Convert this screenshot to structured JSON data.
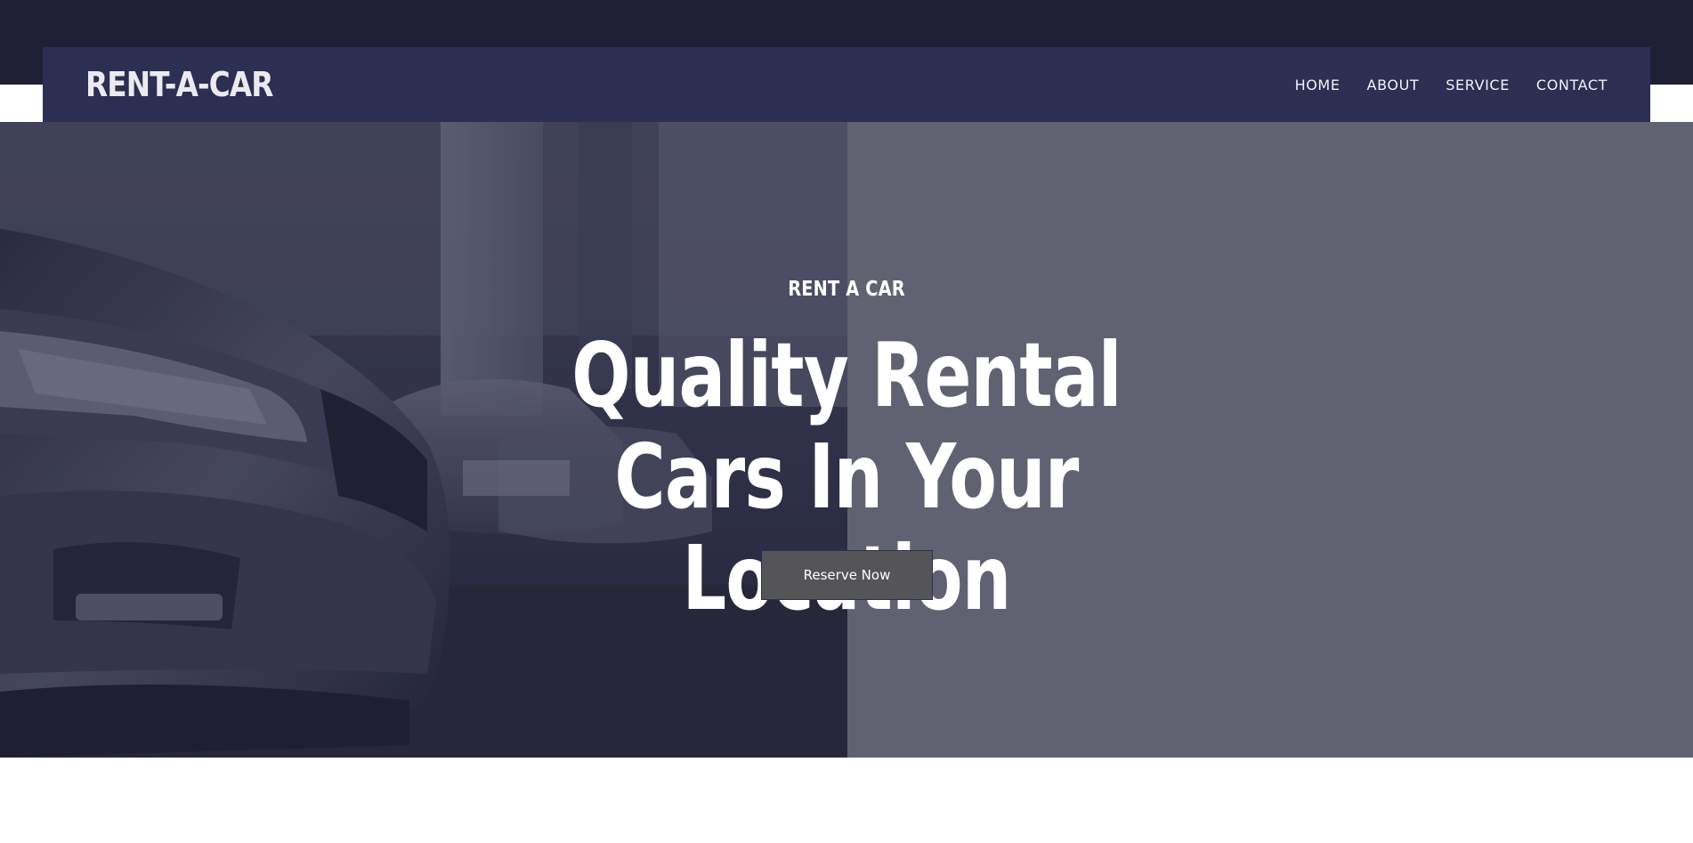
{
  "header": {
    "brand": "RENT-A-CAR",
    "nav": [
      {
        "label": "HOME"
      },
      {
        "label": "ABOUT"
      },
      {
        "label": "SERVICE"
      },
      {
        "label": "CONTACT"
      }
    ]
  },
  "hero": {
    "eyebrow": "RENT A CAR",
    "headline": "Quality Rental Cars In Your Location",
    "cta_label": "Reserve Now",
    "image_alt": "row-of-parked-cars-photo"
  },
  "colors": {
    "top_strip": "#1f2036",
    "navbar": "#2c2f52",
    "panel": "#606271",
    "button": "#555558",
    "text": "#ffffff"
  }
}
